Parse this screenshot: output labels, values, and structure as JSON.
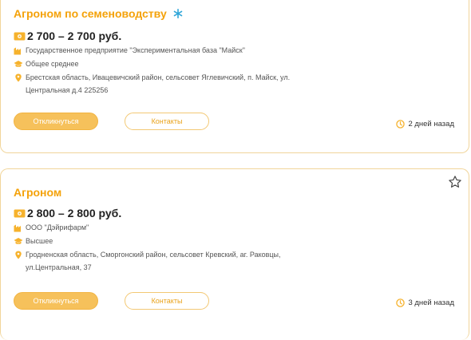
{
  "colors": {
    "accent": "#f4a20a",
    "border": "#f1d59a",
    "button": "#f6c15b",
    "sparkle": "#2fa6d8"
  },
  "jobs": [
    {
      "title": "Агроном по семеноводству",
      "has_sparkle": true,
      "salary": "2 700 – 2 700 руб.",
      "company": "Государственное предприятие \"Экспериментальная база \"Майск\"",
      "education": "Общее среднее",
      "address": "Брестская область, Ивацевичский район, сельсовет Яглевичский, п. Майск, ул. Центральная д.4 225256",
      "respond_label": "Откликнуться",
      "contacts_label": "Контакты",
      "posted": "2 дней назад"
    },
    {
      "title": "Агроном",
      "salary": "2 800 – 2 800 руб.",
      "company": "ООО \"Дэйрифарм\"",
      "education": "Высшее",
      "address": "Гродненская область, Сморгонский район, сельсовет Кревский, аг. Раковцы, ул.Центральная, 37",
      "respond_label": "Откликнуться",
      "contacts_label": "Контакты",
      "posted": "3 дней назад"
    }
  ],
  "icons": {
    "favorite": "star-outline-icon",
    "salary": "money-icon",
    "company": "factory-icon",
    "education": "graduation-cap-icon",
    "address": "location-pin-icon",
    "posted": "clock-icon",
    "sparkle": "sparkle-icon"
  }
}
